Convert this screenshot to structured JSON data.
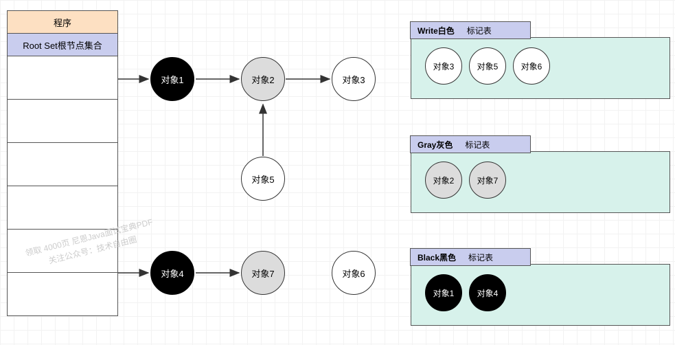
{
  "left_stack": {
    "program_label": "程序",
    "rootset_label": "Root Set根节点集合"
  },
  "nodes": {
    "obj1": "对象1",
    "obj2": "对象2",
    "obj3": "对象3",
    "obj4": "对象4",
    "obj5": "对象5",
    "obj6": "对象6",
    "obj7": "对象7"
  },
  "panels": {
    "white": {
      "title": "Write白色",
      "subtitle": "标记表",
      "items": [
        "对象3",
        "对象5",
        "对象6"
      ]
    },
    "gray": {
      "title": "Gray灰色",
      "subtitle": "标记表",
      "items": [
        "对象2",
        "对象7"
      ]
    },
    "black": {
      "title": "Black黑色",
      "subtitle": "标记表",
      "items": [
        "对象1",
        "对象4"
      ]
    }
  },
  "watermark": {
    "line1": "领取 4000页 尼恩Java面试宝典PDF",
    "line2": "关注公众号：技术自由圈"
  }
}
